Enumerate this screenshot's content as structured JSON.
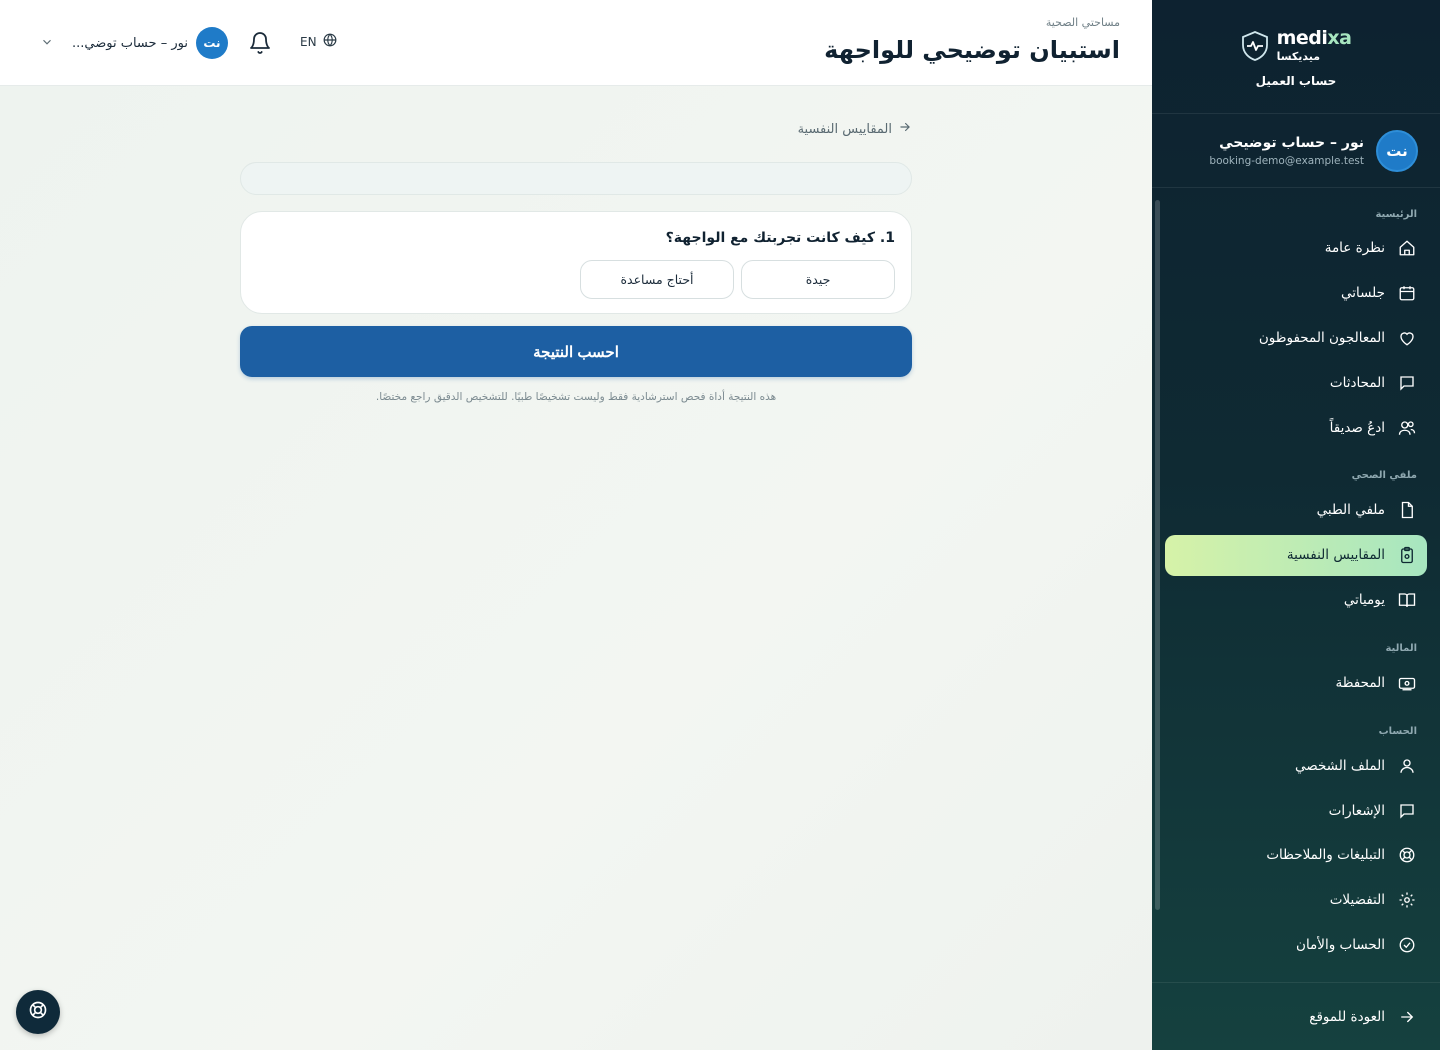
{
  "header": {
    "breadcrumb": "مساحتي الصحية",
    "title": "استبيان توضيحي للواجهة",
    "language": "EN",
    "user_initials": "نت",
    "user_name": "نور – حساب توضي..."
  },
  "sidebar": {
    "brand_en_part1": "medi",
    "brand_en_part2": "xa",
    "brand_ar": "ميديكسا",
    "account_type": "حساب العميل",
    "profile": {
      "initials": "نت",
      "name": "نور – حساب توضيحي",
      "email": "booking-demo@example.test"
    },
    "sections": {
      "home": "الرئيسية",
      "health": "ملفي الصحي",
      "finance": "المالية",
      "account": "الحساب"
    },
    "items": {
      "overview": "نظرة عامة",
      "sessions": "جلساتي",
      "saved_therapists": "المعالجون المحفوظون",
      "chats": "المحادثات",
      "invite": "ادعُ صديقاً",
      "medical_file": "ملفي الطبي",
      "psych_scales": "المقاييس النفسية",
      "diary": "يومياتي",
      "wallet": "المحفظة",
      "profile": "الملف الشخصي",
      "notifications": "الإشعارات",
      "reports": "التبليغات والملاحظات",
      "preferences": "التفضيلات",
      "security": "الحساب والأمان"
    },
    "back_to_site": "العودة للموقع"
  },
  "main": {
    "back_label": "المقاييس النفسية",
    "question": "1. كيف كانت تجربتك مع الواجهة؟",
    "options": [
      "جيدة",
      "أحتاج مساعدة"
    ],
    "submit": "احسب النتيجة",
    "disclaimer": "هذه النتيجة أداة فحص استرشادية فقط وليست تشخيصًا طبيًا. للتشخيص الدقيق راجع مختصًا."
  },
  "colors": {
    "primary_button": "#1d5fa3",
    "sidebar_bg": "#0f2a33",
    "active_item": "#a7e6c0",
    "avatar": "#1f7bc8"
  }
}
